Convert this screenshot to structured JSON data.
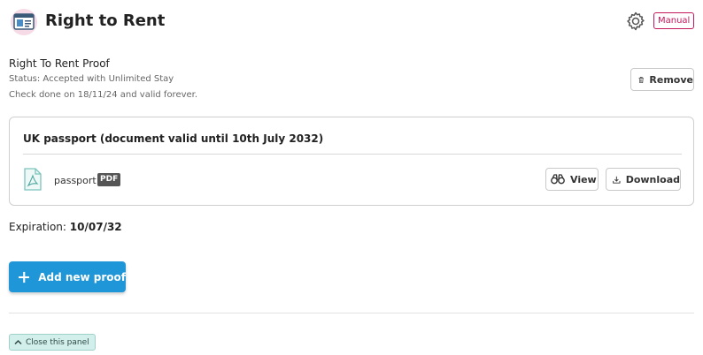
{
  "header": {
    "title": "Right to Rent",
    "icon": "id-card-icon",
    "settings_icon": "gear-icon",
    "mode_badge": "Manual"
  },
  "proof": {
    "title": "Right To Rent Proof",
    "status": "Status: Accepted with Unlimited Stay",
    "check_note": "Check done on 18/11/24 and valid forever.",
    "remove_label": "Remove"
  },
  "document": {
    "title": "UK passport (document valid until 10th July 2032)",
    "file_name": "passport",
    "file_type": "PDF",
    "view_label": "View",
    "download_label": "Download"
  },
  "expiration": {
    "label": "Expiration:",
    "value": "10/07/32"
  },
  "actions": {
    "add_label": "Add new proof",
    "close_label": "Close this panel"
  },
  "colors": {
    "primary": "#1e96d8",
    "manual_badge": "#c2185b",
    "close_panel_bg": "#d3efec"
  }
}
